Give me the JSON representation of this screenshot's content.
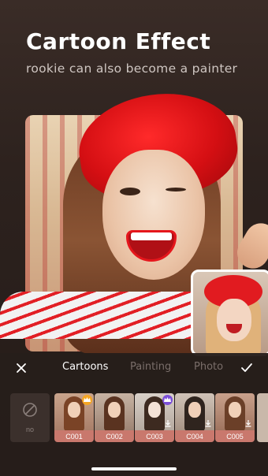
{
  "header": {
    "title": "Cartoon Effect",
    "subtitle": "rookie can also become a painter"
  },
  "tabs": [
    {
      "label": "Cartoons",
      "active": true
    },
    {
      "label": "Painting",
      "active": false
    },
    {
      "label": "Photo",
      "active": false
    }
  ],
  "filters": {
    "none_label": "no",
    "items": [
      {
        "label": "C001",
        "badge": "crown-orange",
        "download": false
      },
      {
        "label": "C002",
        "badge": null,
        "download": false
      },
      {
        "label": "C003",
        "badge": "crown-purple",
        "download": true
      },
      {
        "label": "C004",
        "badge": null,
        "download": true
      },
      {
        "label": "C005",
        "badge": null,
        "download": true
      }
    ]
  },
  "icons": {
    "close": "close-icon",
    "confirm": "checkmark-icon",
    "none": "no-filter-icon",
    "crown": "crown-icon",
    "download": "download-icon"
  },
  "colors": {
    "background": "#2d221e",
    "panel": "#261e1b",
    "active_tab": "#ffffff",
    "inactive_tab": "#7a6e6a",
    "filter_label_bg": "#c9786d",
    "crown_orange": "#f5a623",
    "crown_purple": "#7b4fd8",
    "accent_red": "#e21f25"
  }
}
